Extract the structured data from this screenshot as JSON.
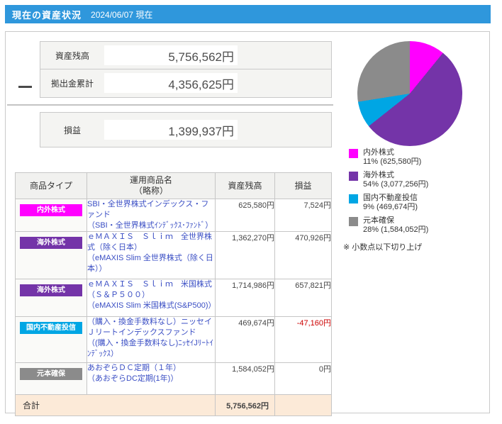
{
  "header": {
    "title": "現在の資産状況",
    "date": "2024/06/07 現在"
  },
  "summary": {
    "balance_label": "資産残高",
    "balance_value": "5,756,562円",
    "contrib_label": "拠出金累計",
    "contrib_value": "4,356,625円",
    "pl_label": "損益",
    "pl_value": "1,399,937円"
  },
  "pie": {
    "note": "※ 小数点以下切り上げ",
    "slices": [
      {
        "label": "内外株式",
        "detail": "11% (625,580円)",
        "percent": 10.87,
        "color": "#ff00ff"
      },
      {
        "label": "海外株式",
        "detail": "54% (3,077,256円)",
        "percent": 53.46,
        "color": "#7434a8"
      },
      {
        "label": "国内不動産投信",
        "detail": "9% (469,674円)",
        "percent": 8.16,
        "color": "#00a6e4"
      },
      {
        "label": "元本確保",
        "detail": "28% (1,584,052円)",
        "percent": 27.51,
        "color": "#8b8b8b"
      }
    ]
  },
  "table": {
    "col_type": "商品タイプ",
    "col_name": "運用商品名",
    "col_name_sub": "（略称）",
    "col_balance": "資産残高",
    "col_pl": "損益",
    "rows": [
      {
        "type": "内外株式",
        "type_color": "#ff00ff",
        "name": "SBI・全世界株式インデックス・ファンド",
        "abbr": "（SBI・全世界株式ｲﾝﾃﾞｯｸｽ･ﾌｧﾝﾄﾞ）",
        "balance": "625,580円",
        "pl": "7,524円",
        "pl_negative": false
      },
      {
        "type": "海外株式",
        "type_color": "#7434a8",
        "name": "ｅＭＡＸＩＳ　Ｓｌｉｍ　全世界株式（除く日本）",
        "abbr": "（eMAXIS Slim 全世界株式（除く日本））",
        "balance": "1,362,270円",
        "pl": "470,926円",
        "pl_negative": false
      },
      {
        "type": "海外株式",
        "type_color": "#7434a8",
        "name": "ｅＭＡＸＩＳ　Ｓｌｉｍ　米国株式（Ｓ＆Ｐ５００）",
        "abbr": "（eMAXIS Slim 米国株式(S&P500)）",
        "balance": "1,714,986円",
        "pl": "657,821円",
        "pl_negative": false
      },
      {
        "type": "国内不動産投信",
        "type_color": "#00a6e4",
        "name": "（購入・換金手数料なし）ニッセイＪリートインデックスファンド",
        "abbr": "（(購入・換金手数料なし)ﾆｯｾｲJﾘｰﾄｲﾝﾃﾞｯｸｽ）",
        "balance": "469,674円",
        "pl": "-47,160円",
        "pl_negative": true
      },
      {
        "type": "元本確保",
        "type_color": "#8b8b8b",
        "name": "あおぞらＤＣ定期（１年）",
        "abbr": "（あおぞらDC定期(1年)）",
        "balance": "1,584,052円",
        "pl": "0円",
        "pl_negative": false
      }
    ],
    "total_label": "合計",
    "total_balance": "5,756,562円"
  },
  "chart_data": {
    "type": "pie",
    "title": "",
    "categories": [
      "内外株式",
      "海外株式",
      "国内不動産投信",
      "元本確保"
    ],
    "values": [
      625580,
      3077256,
      469674,
      1584052
    ],
    "percent_labels": [
      "11%",
      "54%",
      "9%",
      "28%"
    ],
    "legend_position": "bottom"
  }
}
